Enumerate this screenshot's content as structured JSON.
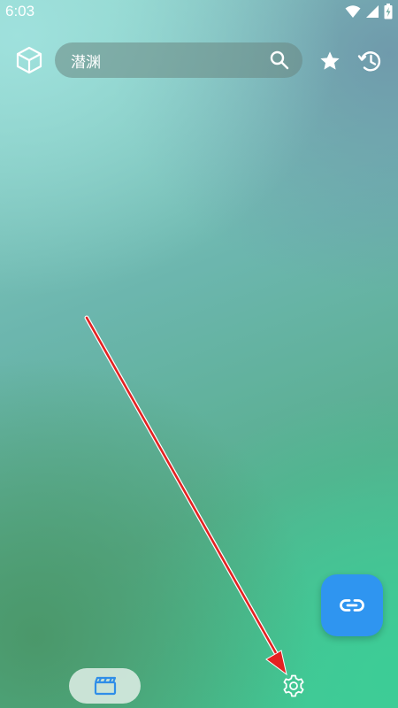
{
  "status_bar": {
    "time": "6:03",
    "icons": [
      "wifi-icon",
      "cellular-signal-icon",
      "battery-charging-icon"
    ]
  },
  "header": {
    "logo_icon": "cube-icon",
    "search": {
      "value": "潜渊",
      "icon": "search-icon"
    },
    "favorites_icon": "star-icon",
    "history_icon": "history-icon"
  },
  "fab": {
    "icon": "link-icon",
    "color": "#2f95f0"
  },
  "bottom_nav": {
    "items": [
      {
        "icon": "movie-clapper-icon",
        "selected": true
      },
      {
        "icon": "settings-gear-icon",
        "selected": false
      }
    ]
  },
  "annotation": {
    "type": "red-arrow",
    "color": "#e32222",
    "points_to": "settings-gear-icon"
  }
}
